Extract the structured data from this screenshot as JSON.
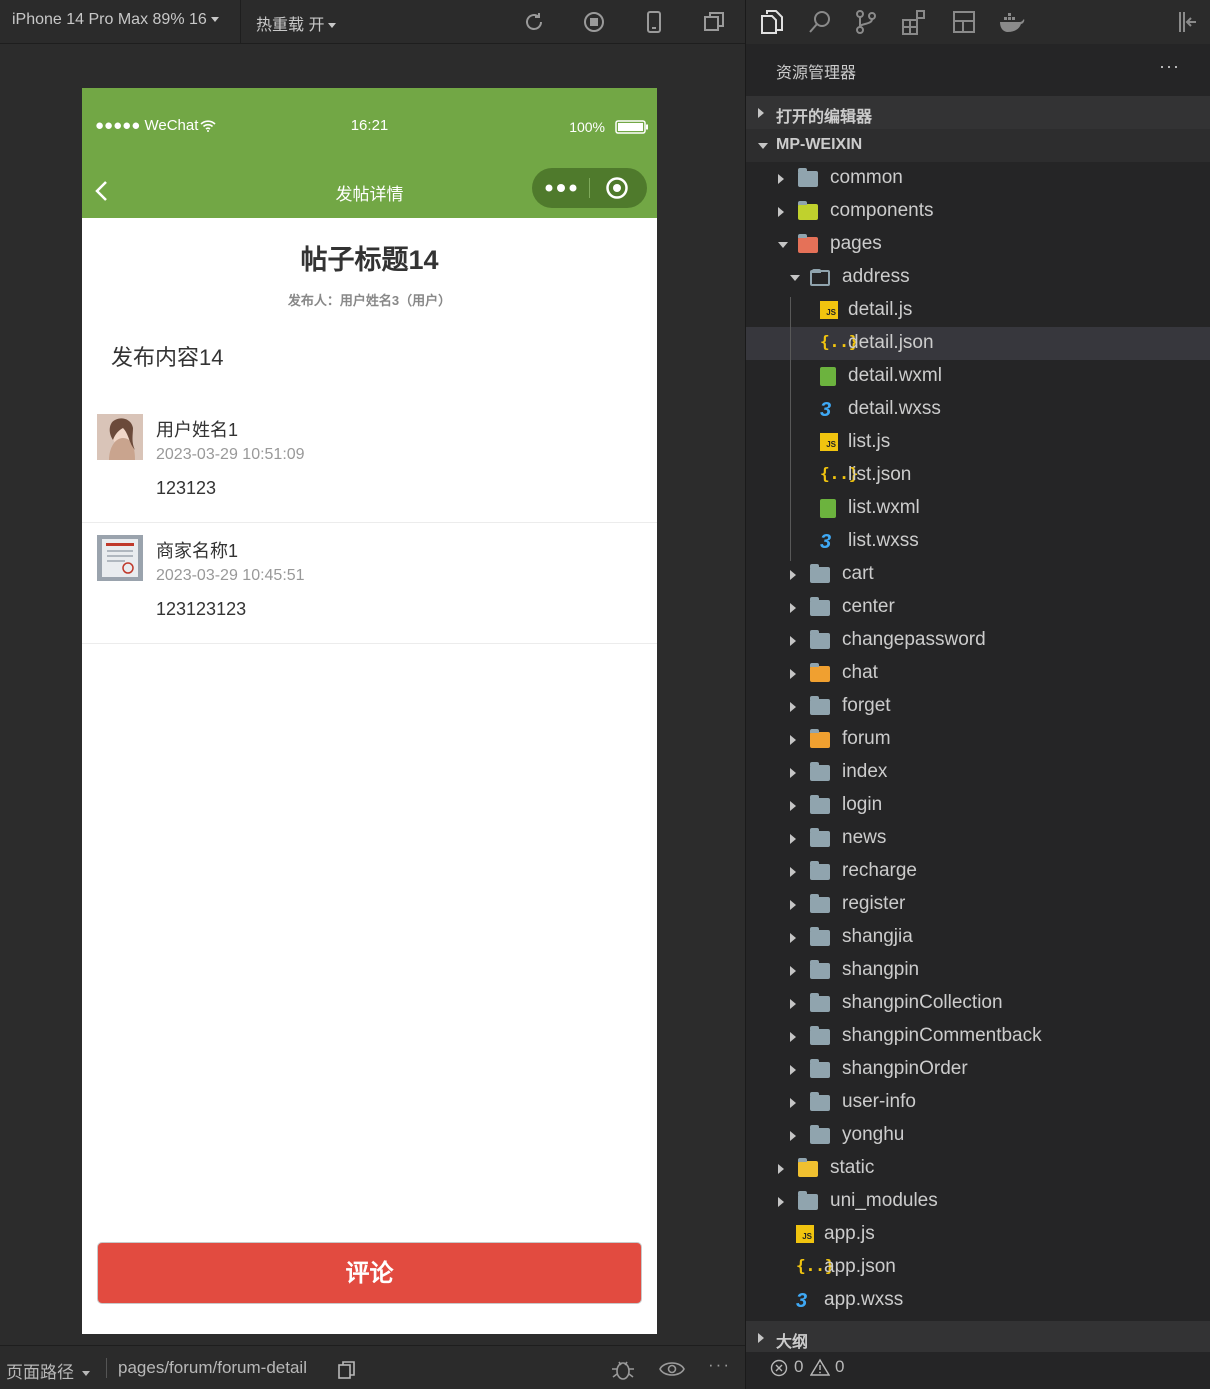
{
  "simulator": {
    "device_label": "iPhone 14 Pro Max 89% 16",
    "hot_reload_label": "热重载 开",
    "footer": {
      "path_label": "页面路径",
      "path_value": "pages/forum/forum-detail"
    }
  },
  "phone": {
    "status": {
      "carrier": "●●●●● WeChat",
      "time": "16:21",
      "battery": "100%"
    },
    "nav_title": "发帖详情",
    "post": {
      "title": "帖子标题14",
      "meta": "发布人：用户姓名3（用户）",
      "content": "发布内容14"
    },
    "comments": [
      {
        "name": "用户姓名1",
        "time": "2023-03-29 10:51:09",
        "text": "123123"
      },
      {
        "name": "商家名称1",
        "time": "2023-03-29 10:45:51",
        "text": "123123123"
      }
    ],
    "comment_button": "评论",
    "colors": {
      "nav": "#72a745",
      "button": "#e24b40"
    }
  },
  "explorer": {
    "title": "资源管理器",
    "more": "···",
    "open_editors": "打开的编辑器",
    "project": "MP-WEIXIN",
    "outline": "大纲",
    "problems": {
      "errors": "0",
      "warnings": "0"
    },
    "tree": [
      {
        "name": "common",
        "type": "folder"
      },
      {
        "name": "components",
        "type": "folder"
      },
      {
        "name": "pages",
        "type": "folder"
      },
      {
        "name": "address",
        "type": "folder"
      },
      {
        "name": "detail.js",
        "type": "js"
      },
      {
        "name": "detail.json",
        "type": "json"
      },
      {
        "name": "detail.wxml",
        "type": "wxml"
      },
      {
        "name": "detail.wxss",
        "type": "wxss"
      },
      {
        "name": "list.js",
        "type": "js"
      },
      {
        "name": "list.json",
        "type": "json"
      },
      {
        "name": "list.wxml",
        "type": "wxml"
      },
      {
        "name": "list.wxss",
        "type": "wxss"
      },
      {
        "name": "cart",
        "type": "folder"
      },
      {
        "name": "center",
        "type": "folder"
      },
      {
        "name": "changepassword",
        "type": "folder"
      },
      {
        "name": "chat",
        "type": "folder"
      },
      {
        "name": "forget",
        "type": "folder"
      },
      {
        "name": "forum",
        "type": "folder"
      },
      {
        "name": "index",
        "type": "folder"
      },
      {
        "name": "login",
        "type": "folder"
      },
      {
        "name": "news",
        "type": "folder"
      },
      {
        "name": "recharge",
        "type": "folder"
      },
      {
        "name": "register",
        "type": "folder"
      },
      {
        "name": "shangjia",
        "type": "folder"
      },
      {
        "name": "shangpin",
        "type": "folder"
      },
      {
        "name": "shangpinCollection",
        "type": "folder"
      },
      {
        "name": "shangpinCommentback",
        "type": "folder"
      },
      {
        "name": "shangpinOrder",
        "type": "folder"
      },
      {
        "name": "user-info",
        "type": "folder"
      },
      {
        "name": "yonghu",
        "type": "folder"
      },
      {
        "name": "static",
        "type": "folder"
      },
      {
        "name": "uni_modules",
        "type": "folder"
      },
      {
        "name": "app.js",
        "type": "js"
      },
      {
        "name": "app.json",
        "type": "json"
      },
      {
        "name": "app.wxss",
        "type": "wxss"
      }
    ],
    "selected": "detail.json"
  }
}
